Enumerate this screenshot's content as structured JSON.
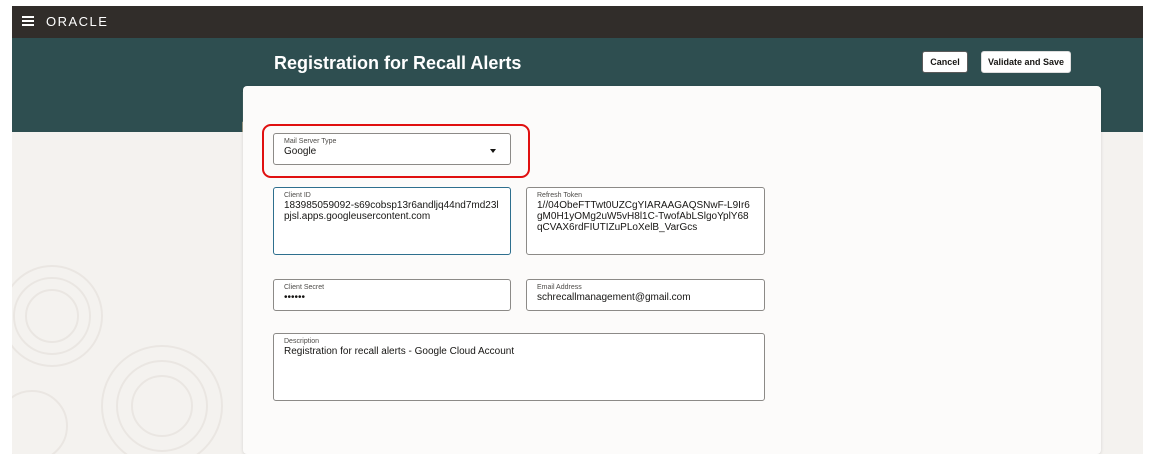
{
  "app": {
    "brand": "ORACLE"
  },
  "header": {
    "title": "Registration for Recall Alerts",
    "cancel_label": "Cancel",
    "save_label": "Validate and Save"
  },
  "form": {
    "mail_server_type": {
      "label": "Mail Server Type",
      "value": "Google"
    },
    "client_id": {
      "label": "Client ID",
      "value": "183985059092-s69cobsp13r6andljq44nd7md23lpjsl.apps.googleusercontent.com"
    },
    "refresh_token": {
      "label": "Refresh Token",
      "value": "1//04ObeFTTwt0UZCgYIARAAGAQSNwF-L9Ir6gM0H1yOMg2uW5vH8l1C-TwofAbLSlgoYplY68qCVAX6rdFIUTIZuPLoXelB_VarGcs"
    },
    "client_secret": {
      "label": "Client Secret",
      "value": "••••••"
    },
    "email_address": {
      "label": "Email Address",
      "value": "schrecallmanagement@gmail.com"
    },
    "description": {
      "label": "Description",
      "value": "Registration for recall alerts - Google Cloud Account"
    }
  },
  "colors": {
    "topbar": "#312d2a",
    "banner": "#2e4e50",
    "highlight": "#e01010",
    "focus": "#2e6f8e"
  },
  "icons": [
    "hamburger-menu-icon",
    "chevron-down-icon"
  ]
}
